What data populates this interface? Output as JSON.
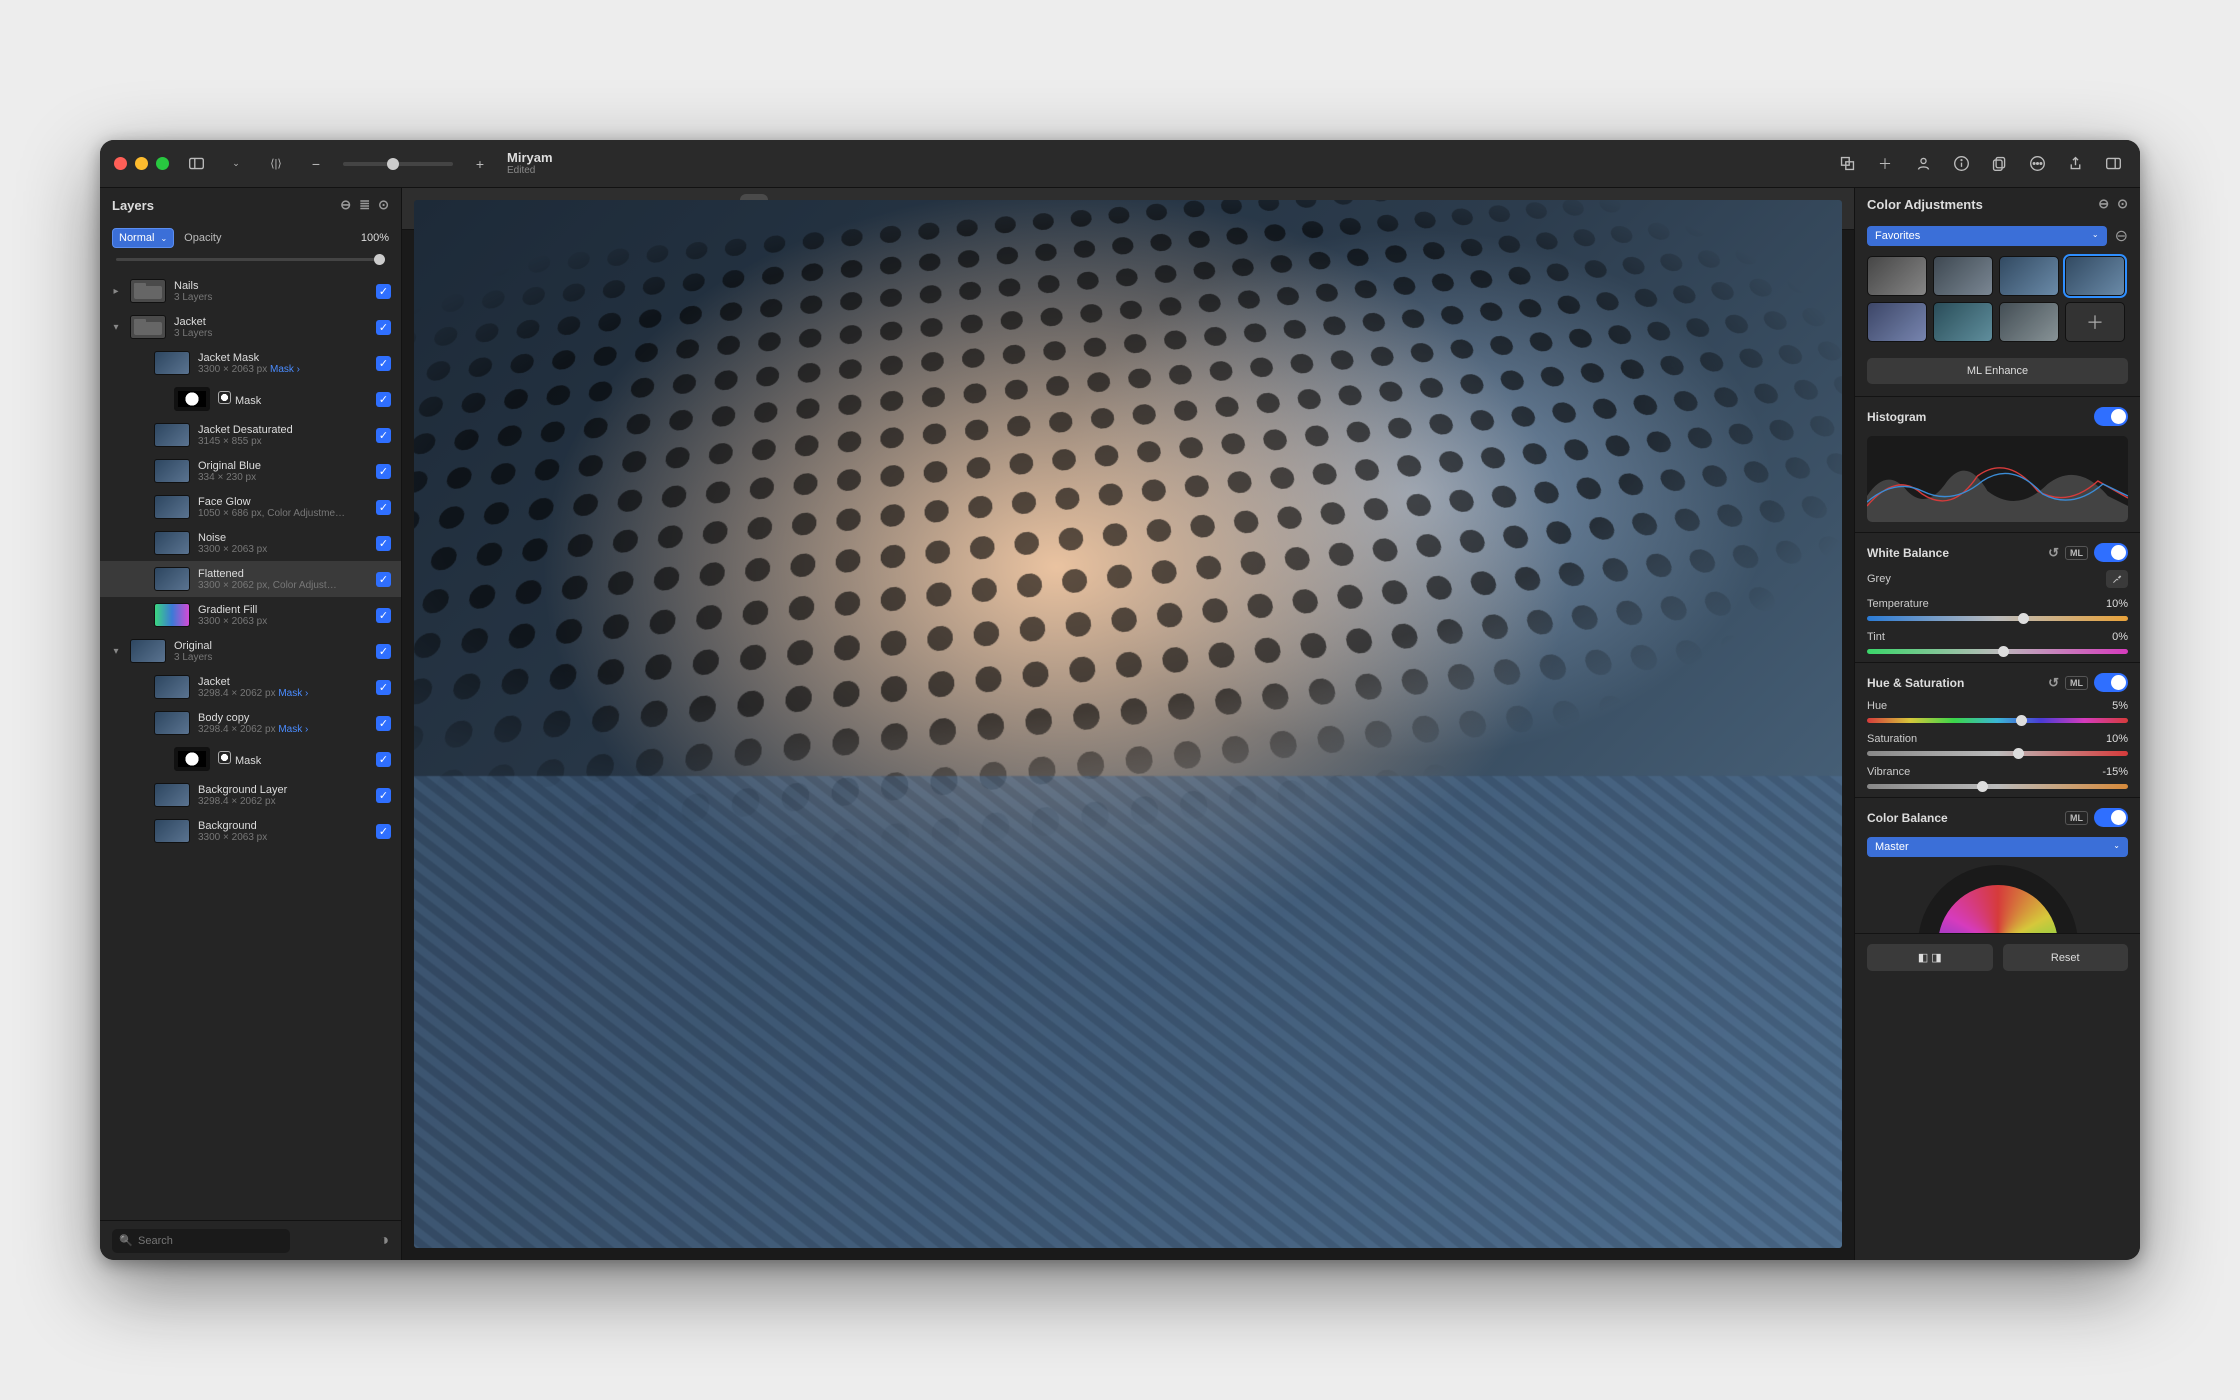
{
  "document": {
    "title": "Miryam",
    "status": "Edited"
  },
  "left_panel": {
    "title": "Layers",
    "blend_mode": "Normal",
    "opacity_label": "Opacity",
    "opacity_value": "100%",
    "search_placeholder": "Search",
    "layers": [
      {
        "name": "Nails",
        "meta": "3 Layers",
        "type": "folder",
        "indent": 0,
        "disclosure": "right"
      },
      {
        "name": "Jacket",
        "meta": "3 Layers",
        "type": "folder",
        "indent": 0,
        "disclosure": "down"
      },
      {
        "name": "Jacket Mask",
        "meta": "3300 × 2063 px",
        "mask_link": "Mask",
        "indent": 1
      },
      {
        "name": "Mask",
        "meta": "",
        "type": "mask",
        "indent": 2,
        "mask_icon": true
      },
      {
        "name": "Jacket Desaturated",
        "meta": "3145 × 855 px",
        "indent": 1
      },
      {
        "name": "Original Blue",
        "meta": "334 × 230 px",
        "indent": 1
      },
      {
        "name": "Face Glow",
        "meta": "1050 × 686 px, Color Adjustme…",
        "indent": 1
      },
      {
        "name": "Noise",
        "meta": "3300 × 2063 px",
        "indent": 1
      },
      {
        "name": "Flattened",
        "meta": "3300 × 2062 px, Color Adjust…",
        "indent": 1,
        "selected": true
      },
      {
        "name": "Gradient Fill",
        "meta": "3300 × 2063 px",
        "type": "grad",
        "indent": 1
      },
      {
        "name": "Original",
        "meta": "3 Layers",
        "indent": 0,
        "disclosure": "down"
      },
      {
        "name": "Jacket",
        "meta": "3298.4 × 2062 px",
        "mask_link": "Mask",
        "indent": 1
      },
      {
        "name": "Body copy",
        "meta": "3298.4 × 2062 px",
        "mask_link": "Mask",
        "indent": 1
      },
      {
        "name": "Mask",
        "meta": "",
        "type": "mask",
        "indent": 2,
        "mask_icon": true
      },
      {
        "name": "Background Layer",
        "meta": "3298.4 × 2062 px",
        "indent": 1
      },
      {
        "name": "Background",
        "meta": "3300 × 2063 px",
        "indent": 1
      }
    ]
  },
  "right_panel": {
    "title": "Color Adjustments",
    "favorites_label": "Favorites",
    "ml_enhance": "ML Enhance",
    "histogram": {
      "label": "Histogram"
    },
    "white_balance": {
      "label": "White Balance",
      "ml_badge": "ML",
      "grey_label": "Grey",
      "temperature": {
        "label": "Temperature",
        "value": "10%"
      },
      "tint": {
        "label": "Tint",
        "value": "0%"
      }
    },
    "hue_sat": {
      "label": "Hue & Saturation",
      "ml_badge": "ML",
      "hue": {
        "label": "Hue",
        "value": "5%"
      },
      "saturation": {
        "label": "Saturation",
        "value": "10%"
      },
      "vibrance": {
        "label": "Vibrance",
        "value": "-15%"
      }
    },
    "color_balance": {
      "label": "Color Balance",
      "ml_badge": "ML",
      "master": "Master"
    },
    "footer": {
      "compare": "",
      "reset": "Reset"
    }
  },
  "toolbar_icons": [
    "arrow",
    "selection",
    "star",
    "gap",
    "sparkles",
    "wand",
    "heal",
    "clone",
    "brush",
    "gap",
    "rect-fill",
    "rect-grad",
    "eraser",
    "circle-half",
    "blur1",
    "blur2",
    "blur3",
    "contrast",
    "brightness",
    "sparkle2",
    "gap",
    "hand",
    "zoom",
    "crop"
  ]
}
